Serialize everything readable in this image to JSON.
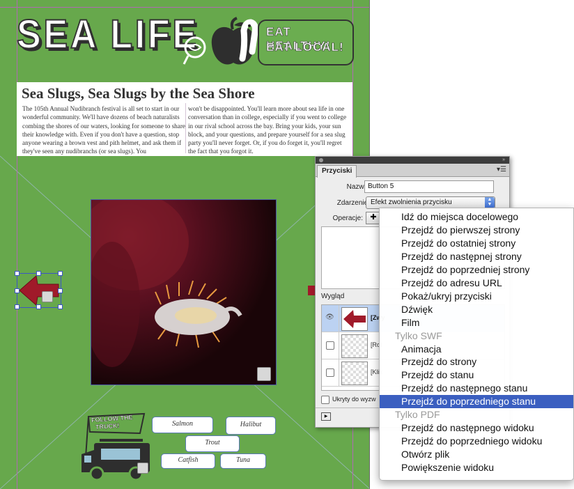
{
  "page": {
    "title": "SEA LIFE",
    "bubble": [
      "EAT HEALTHY!",
      "EAT LOCAL!"
    ],
    "article": {
      "headline": "Sea Slugs, Sea Slugs by the Sea Shore",
      "col1": "The 105th Annual Nudibranch festival is all set to start in our wonderful community. We'll have dozens of beach naturalists combing the shores of our waters, looking for someone to share their knowledge with. Even if you don't have a question, stop anyone wearing a brown vest and pith helmet, and ask them if they've seen any nudibranchs (or sea slugs). You",
      "col2": "won't be disappointed. You'll learn more about sea life in one conversation than in college, especially if you went to college in our rival school across the bay. Bring your kids, your sun block, and your questions, and prepare yourself for a sea slug party you'll never forget. Or, if you do forget it, you'll regret the fact that you forgot it."
    },
    "truck_sign": [
      "FOLLOW THE",
      "TRUCK!"
    ],
    "fish_buttons": [
      "Salmon",
      "Halibut",
      "Trout",
      "Catfish",
      "Tuna"
    ],
    "colors": {
      "page_green": "#67a84c",
      "arrow_red": "#a01a2a",
      "selection_blue": "#3b56c5"
    }
  },
  "panel": {
    "tab": "Przyciski",
    "name_label": "Nazwa:",
    "name_value": "Button 5",
    "event_label": "Zdarzenie:",
    "event_value": "Efekt zwolnienia przycisku",
    "actions_label": "Operacje:",
    "appearance_label": "Wygląd",
    "states": [
      "[Zwy",
      "[Rol",
      "[Klik"
    ],
    "hidden_label": "Ukryty do wyzw"
  },
  "menu": {
    "items": [
      {
        "label": "Idź do miejsca docelowego",
        "type": "item"
      },
      {
        "label": "Przejdź do pierwszej strony",
        "type": "item"
      },
      {
        "label": "Przejdź do ostatniej strony",
        "type": "item"
      },
      {
        "label": "Przejdź do następnej strony",
        "type": "item"
      },
      {
        "label": "Przejdź do poprzedniej strony",
        "type": "item"
      },
      {
        "label": "Przejdź do adresu URL",
        "type": "item"
      },
      {
        "label": "Pokaż/ukryj przyciski",
        "type": "item"
      },
      {
        "label": "Dźwięk",
        "type": "item"
      },
      {
        "label": "Film",
        "type": "item"
      },
      {
        "label": "Tylko SWF",
        "type": "header"
      },
      {
        "label": "Animacja",
        "type": "item"
      },
      {
        "label": "Przejdź do strony",
        "type": "item"
      },
      {
        "label": "Przejdź do stanu",
        "type": "item"
      },
      {
        "label": "Przejdź do następnego stanu",
        "type": "item"
      },
      {
        "label": "Przejdź do poprzedniego stanu",
        "type": "item",
        "highlighted": true
      },
      {
        "label": "Tylko PDF",
        "type": "header"
      },
      {
        "label": "Przejdź do następnego widoku",
        "type": "item"
      },
      {
        "label": "Przejdź do poprzedniego widoku",
        "type": "item"
      },
      {
        "label": "Otwórz plik",
        "type": "item"
      },
      {
        "label": "Powiększenie widoku",
        "type": "item"
      }
    ]
  }
}
